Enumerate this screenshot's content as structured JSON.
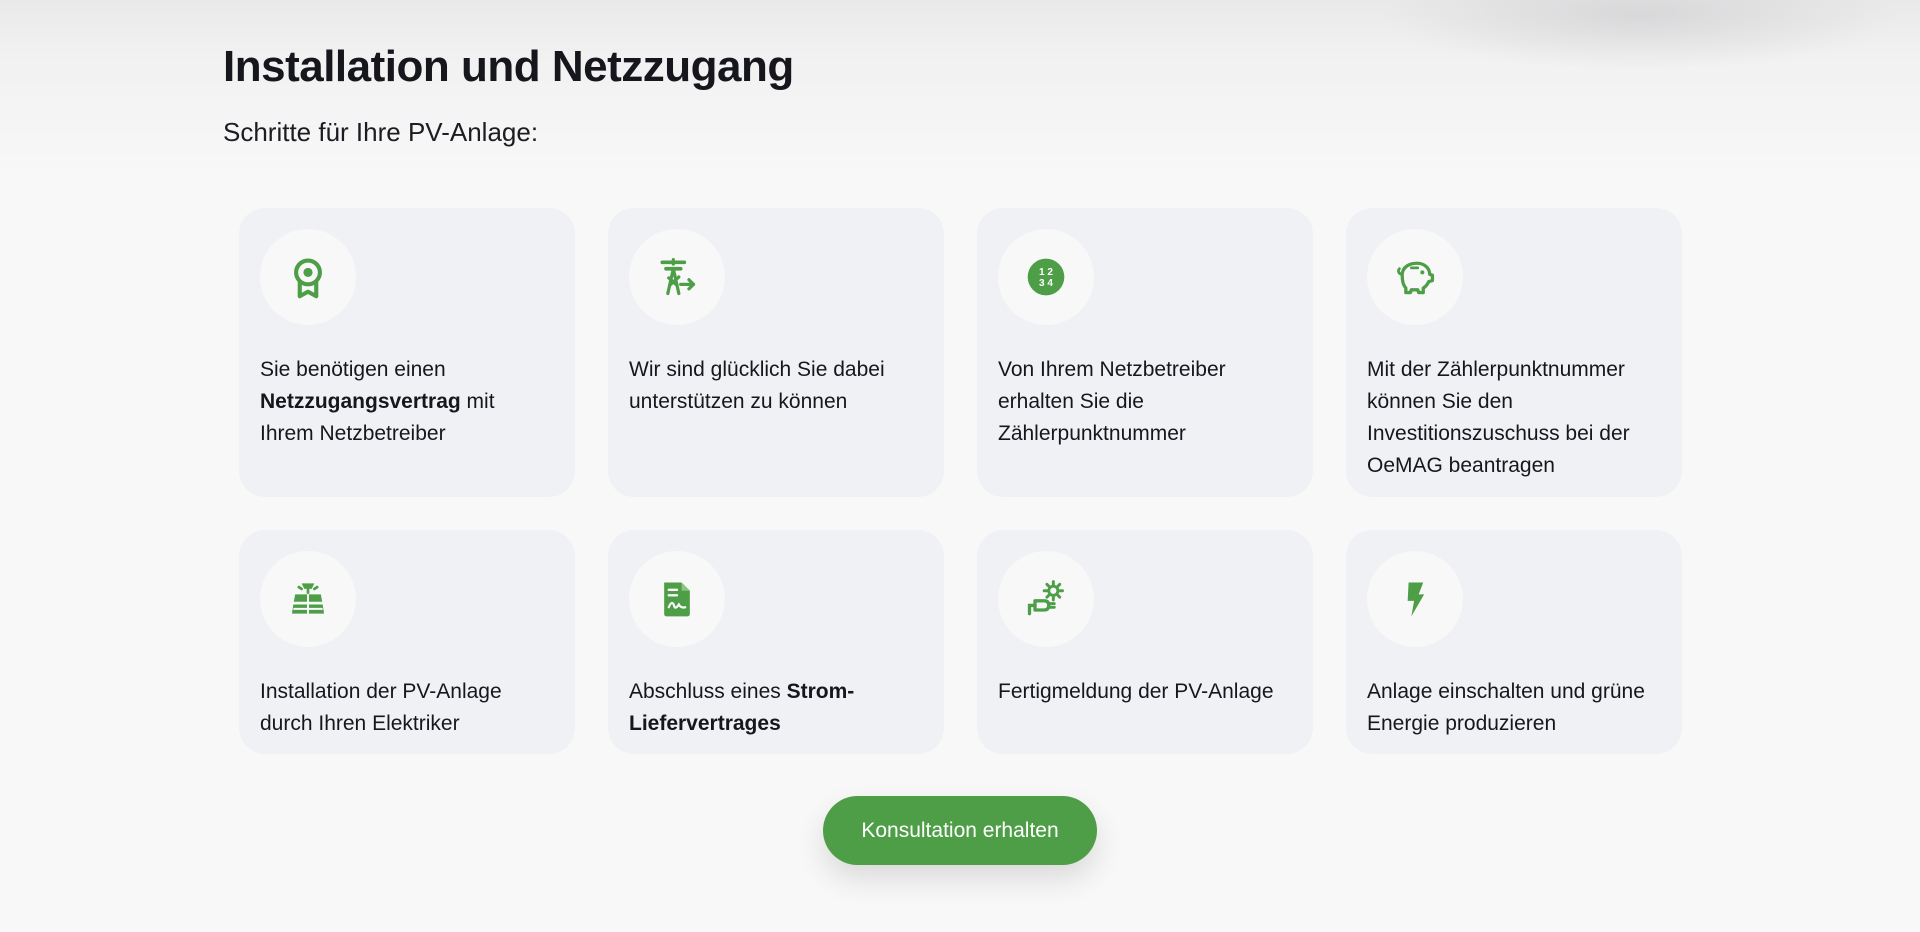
{
  "header": {
    "title": "Installation und Netzzugang",
    "subtitle": "Schritte für Ihre PV-Anlage:"
  },
  "colors": {
    "accent": "#4e9e47",
    "card_bg": "#f0f1f4",
    "page_bg": "#f8f8f9"
  },
  "steps": [
    {
      "icon": "award-icon",
      "pre": "Sie benötigen einen ",
      "bold": "Netzzugangsvertrag",
      "post": " mit Ihrem Netzbetreiber"
    },
    {
      "icon": "power-tower-arrow-icon",
      "pre": "Wir sind glücklich Sie dabei unterstützen zu können",
      "bold": "",
      "post": ""
    },
    {
      "icon": "numbers-1234-icon",
      "pre": "Von Ihrem Netzbetreiber erhalten Sie die Zählerpunktnummer",
      "bold": "",
      "post": ""
    },
    {
      "icon": "piggy-bank-icon",
      "pre": "Mit der Zählerpunktnummer können Sie den Investitionszuschuss bei der OeMAG beantragen",
      "bold": "",
      "post": ""
    },
    {
      "icon": "solar-panel-icon",
      "pre": "Installation der PV-Anlage durch Ihren Elektriker",
      "bold": "",
      "post": ""
    },
    {
      "icon": "contract-document-icon",
      "pre": "Abschluss eines ",
      "bold": "Strom-Liefervertrages",
      "post": ""
    },
    {
      "icon": "plug-gear-icon",
      "pre": "Fertigmeldung der PV-Anlage",
      "bold": "",
      "post": ""
    },
    {
      "icon": "lightning-bolt-icon",
      "pre": "Anlage einschalten und grüne Energie produzieren",
      "bold": "",
      "post": ""
    }
  ],
  "cta": {
    "label": "Konsultation erhalten"
  }
}
